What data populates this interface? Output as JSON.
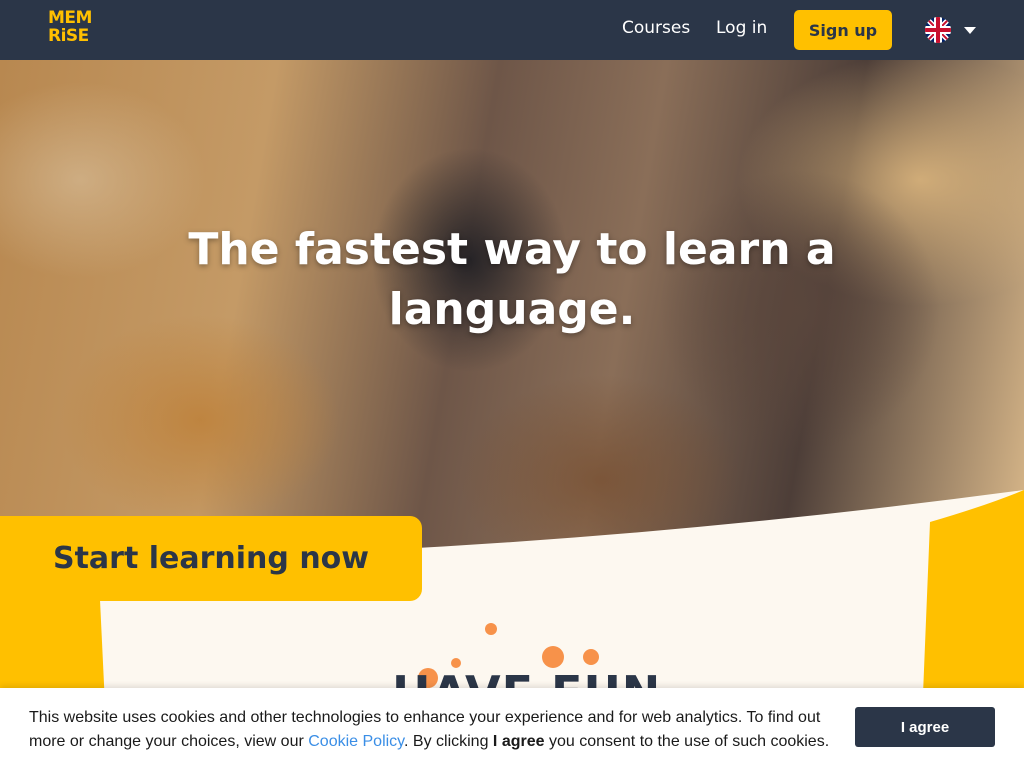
{
  "header": {
    "logo_line1": "MEM",
    "logo_line2": "RiSE",
    "nav_courses": "Courses",
    "nav_login": "Log in",
    "signup": "Sign up",
    "language_icon": "uk-flag-icon",
    "bg_color": "#2b3648",
    "accent_color": "#ffc000"
  },
  "hero": {
    "title": "The fastest way to learn a language."
  },
  "cta": {
    "label": "Start learning now"
  },
  "section": {
    "heading": "HAVE FUN"
  },
  "cookie_banner": {
    "text_before_link": "This website uses cookies and other technologies to enhance your experience and for web analytics. To find out more or change your choices, view our ",
    "link": "Cookie Policy",
    "text_after_link": ". By clicking ",
    "bold": "I agree",
    "text_end": " you consent to the use of such cookies.",
    "button": "I agree",
    "link_color": "#3a8ee6"
  }
}
